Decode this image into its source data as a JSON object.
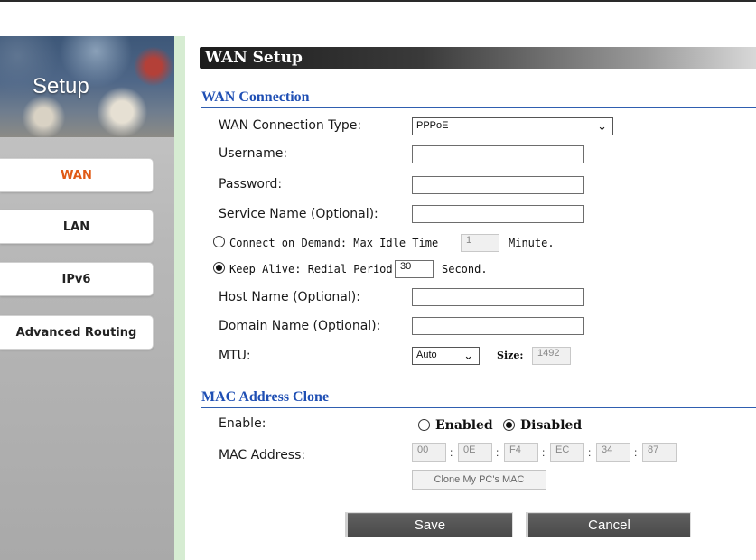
{
  "sidebar": {
    "title": "Setup",
    "items": [
      {
        "label": "WAN"
      },
      {
        "label": "LAN"
      },
      {
        "label": "IPv6"
      },
      {
        "label": "Advanced Routing"
      }
    ],
    "active_item": "WAN",
    "active_color": "#e05a16"
  },
  "page": {
    "title": "WAN Setup"
  },
  "wan_connection": {
    "heading": "WAN Connection",
    "type_label": "WAN Connection Type:",
    "type_value": "PPPoE",
    "username_label": "Username:",
    "username_value": "",
    "password_label": "Password:",
    "password_value": "",
    "service_label": "Service Name (Optional):",
    "service_value": "",
    "on_demand_label": "Connect on Demand: Max Idle Time",
    "on_demand_value": "1",
    "on_demand_unit": "Minute.",
    "on_demand_checked": false,
    "keep_alive_label": "Keep Alive: Redial Period",
    "keep_alive_value": "30",
    "keep_alive_unit": "Second.",
    "keep_alive_checked": true,
    "host_label": "Host Name (Optional):",
    "host_value": "",
    "domain_label": "Domain Name (Optional):",
    "domain_value": "",
    "mtu_label": "MTU:",
    "mtu_value": "Auto",
    "size_label": "Size:",
    "size_value": "1492"
  },
  "mac_clone": {
    "heading": "MAC Address Clone",
    "enable_label": "Enable:",
    "enabled_label": "Enabled",
    "disabled_label": "Disabled",
    "selected": "Disabled",
    "mac_label": "MAC Address:",
    "mac_octets": [
      "00",
      "0E",
      "F4",
      "EC",
      "34",
      "87"
    ],
    "separator": ":",
    "clone_button": "Clone My PC's MAC"
  },
  "actions": {
    "save": "Save",
    "cancel": "Cancel"
  },
  "colors": {
    "section_heading": "#1f4fb4",
    "divider_green": "#d6ecd2"
  }
}
